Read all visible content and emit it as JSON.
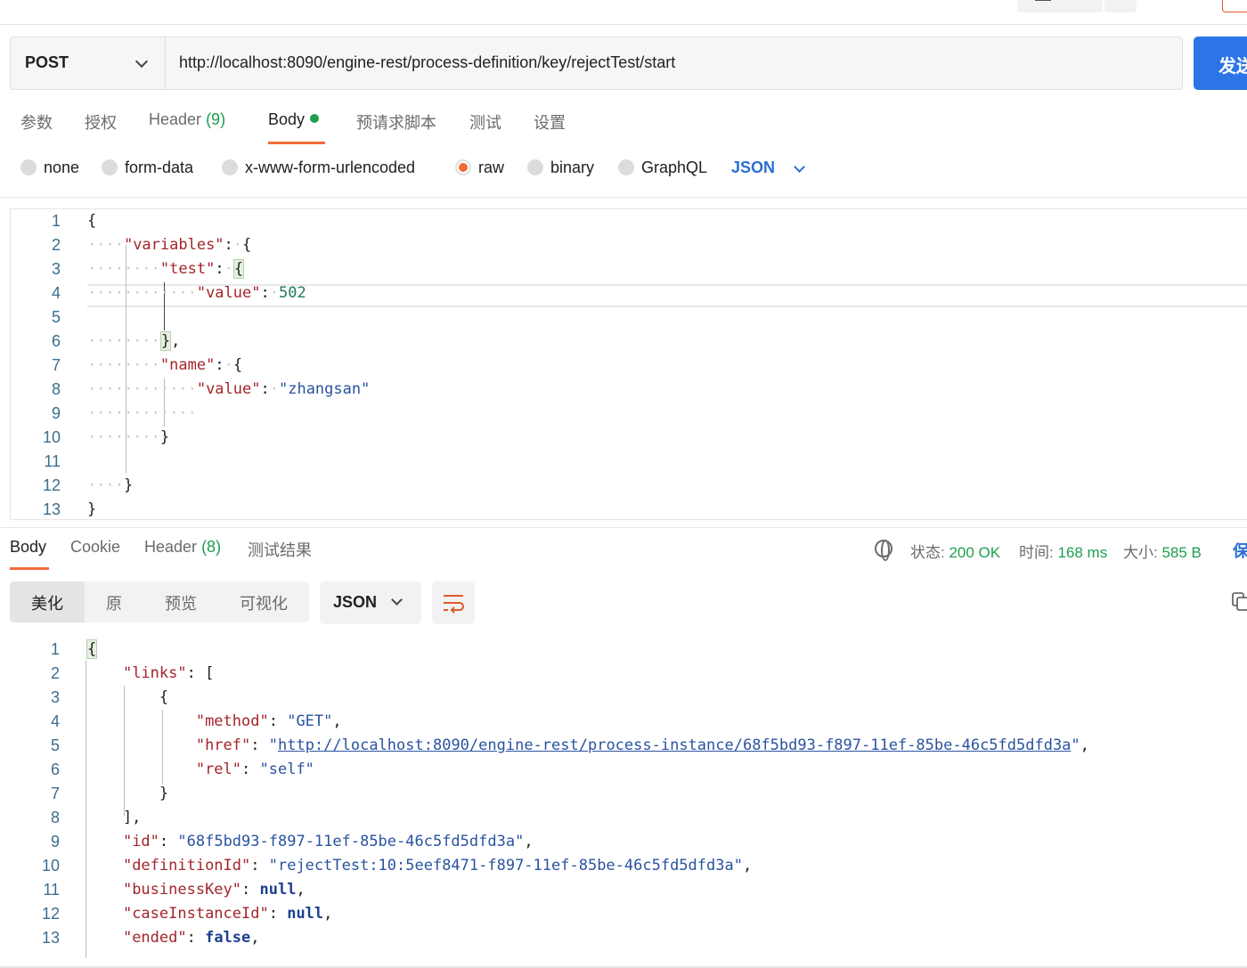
{
  "request": {
    "method": "POST",
    "url": "http://localhost:8090/engine-rest/process-definition/key/rejectTest/start",
    "send_label": "发送"
  },
  "req_tabs": {
    "params": "参数",
    "auth": "授权",
    "header": "Header",
    "header_count": "(9)",
    "body": "Body",
    "prescript": "预请求脚本",
    "tests": "测试",
    "settings": "设置"
  },
  "body_types": {
    "none": "none",
    "form_data": "form-data",
    "urlencoded": "x-www-form-urlencoded",
    "raw": "raw",
    "binary": "binary",
    "graphql": "GraphQL",
    "format": "JSON",
    "selected": "raw"
  },
  "request_body": {
    "line_numbers": [
      "1",
      "2",
      "3",
      "4",
      "5",
      "6",
      "7",
      "8",
      "9",
      "10",
      "11",
      "12",
      "13"
    ],
    "tokens": {
      "k_variables": "\"variables\"",
      "k_test": "\"test\"",
      "k_value": "\"value\"",
      "v_502": "502",
      "k_name": "\"name\"",
      "v_zhangsan": "\"zhangsan\""
    }
  },
  "resp_tabs": {
    "body": "Body",
    "cookie": "Cookie",
    "header": "Header",
    "header_count": "(8)",
    "test_results": "测试结果"
  },
  "resp_status": {
    "status_label": "状态:",
    "status_value": "200 OK",
    "time_label": "时间:",
    "time_value": "168 ms",
    "size_label": "大小:",
    "size_value": "585 B",
    "save_label": "保"
  },
  "view_modes": {
    "pretty": "美化",
    "raw": "原",
    "preview": "预览",
    "visualize": "可视化",
    "format": "JSON"
  },
  "response_body": {
    "line_numbers": [
      "1",
      "2",
      "3",
      "4",
      "5",
      "6",
      "7",
      "8",
      "9",
      "10",
      "11",
      "12",
      "13"
    ],
    "tokens": {
      "k_links": "\"links\"",
      "k_method": "\"method\"",
      "v_get": "\"GET\"",
      "k_href": "\"href\"",
      "v_href": "http://localhost:8090/engine-rest/process-instance/68f5bd93-f897-11ef-85be-46c5fd5dfd3a",
      "k_rel": "\"rel\"",
      "v_self": "\"self\"",
      "k_id": "\"id\"",
      "v_id": "\"68f5bd93-f897-11ef-85be-46c5fd5dfd3a\"",
      "k_definitionId": "\"definitionId\"",
      "v_definitionId": "\"rejectTest:10:5eef8471-f897-11ef-85be-46c5fd5dfd3a\"",
      "k_businessKey": "\"businessKey\"",
      "k_caseInstanceId": "\"caseInstanceId\"",
      "k_ended": "\"ended\"",
      "v_null": "null",
      "v_false": "false"
    }
  },
  "colors": {
    "accent_orange": "#f26b3a",
    "send_blue": "#2c75e6",
    "status_green": "#1d9e4f",
    "json_key": "#a3252b",
    "json_string": "#2a53a0"
  }
}
